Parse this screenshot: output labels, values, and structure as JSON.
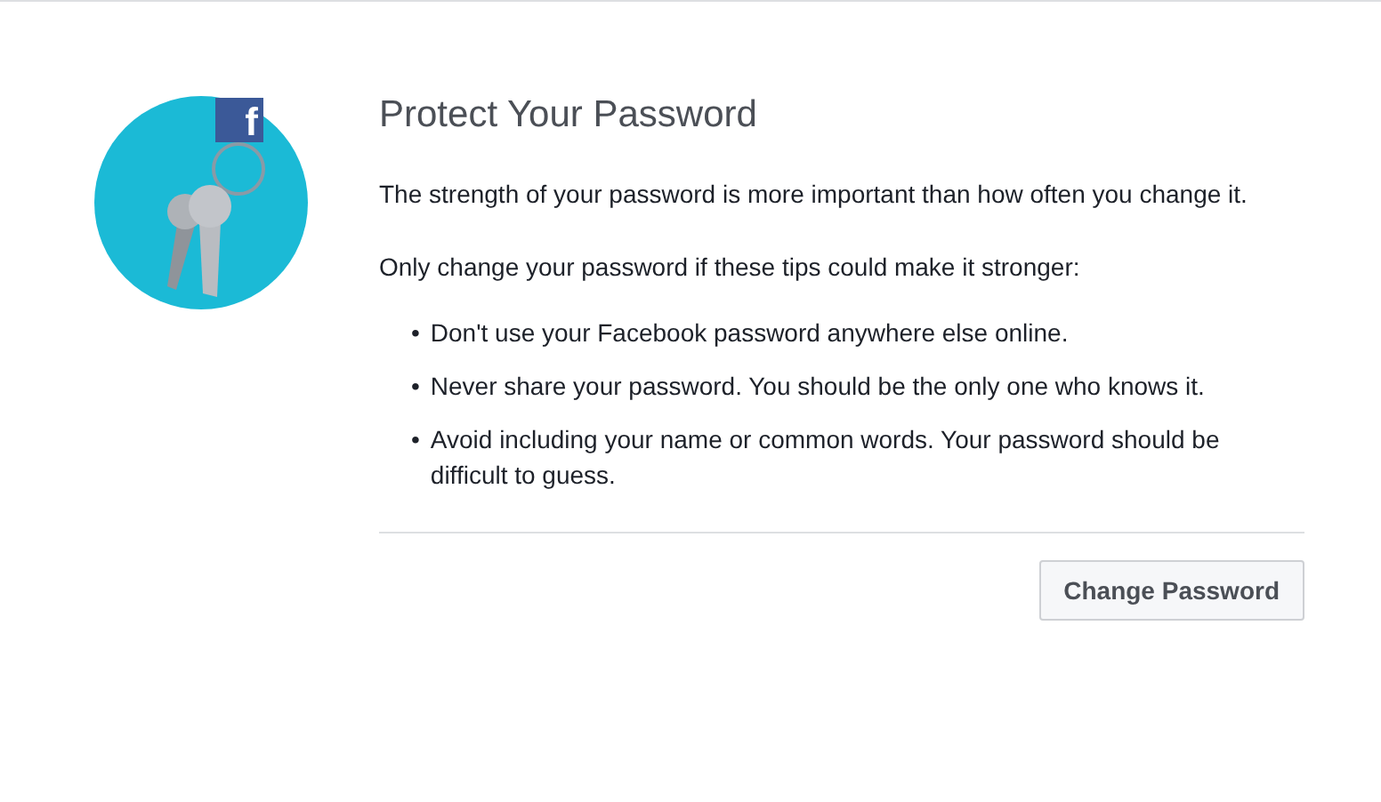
{
  "illustration": {
    "logo_letter": "f"
  },
  "title": "Protect Your Password",
  "intro": "The strength of your password is more important than how often you change it.",
  "lead": "Only change your password if these tips could make it stronger:",
  "tips": [
    {
      "bullet": "•",
      "text": "Don't use your Facebook password anywhere else online."
    },
    {
      "bullet": "•",
      "text": "Never share your password. You should be the only one who knows it."
    },
    {
      "bullet": "•",
      "text": "Avoid including your name or common words. Your password should be difficult to guess."
    }
  ],
  "buttons": [
    "Change Password"
  ]
}
